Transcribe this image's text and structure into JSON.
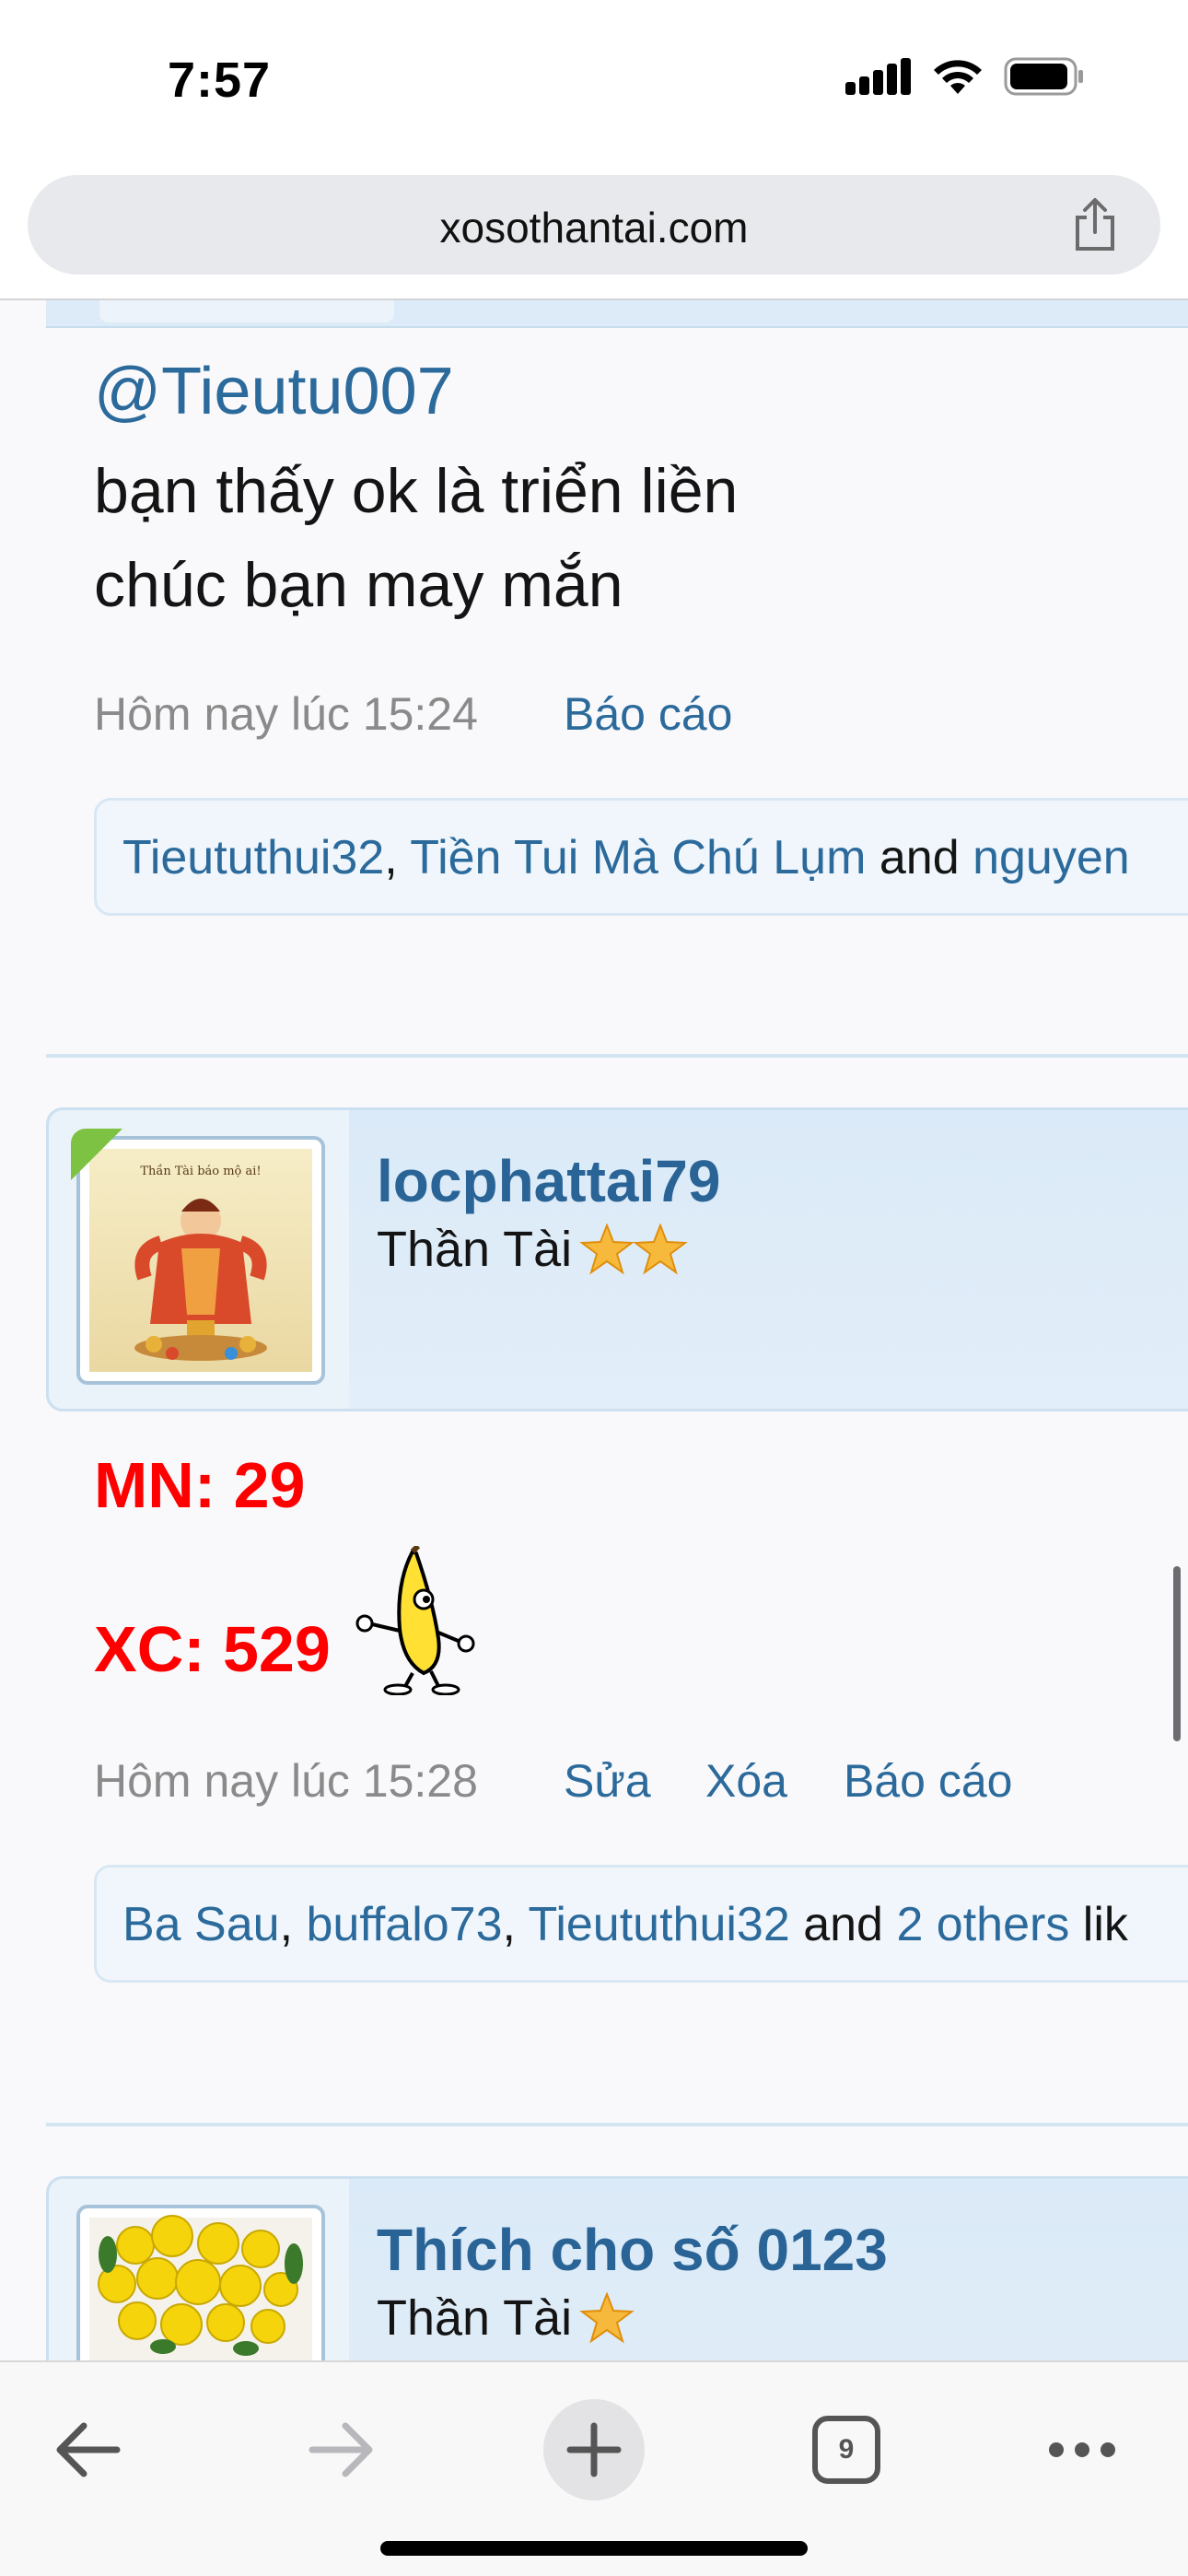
{
  "status_bar": {
    "time": "7:57"
  },
  "browser": {
    "url": "xosothantai.com",
    "tab_count": "9"
  },
  "posts": [
    {
      "mention": "@Tieutu007",
      "lines": [
        "bạn thấy ok là triển liền",
        "chúc bạn may mắn"
      ],
      "timestamp": "Hôm nay lúc 15:24",
      "actions": [
        "Báo cáo"
      ],
      "likes": {
        "users": [
          "Tieututhui32",
          "Tiền Tui Mà Chú Lụm",
          "nguyen"
        ],
        "and_text": "and",
        "sep": ", "
      }
    },
    {
      "username": "locphattai79",
      "title": "Thần Tài",
      "stars": 2,
      "content_lines": [
        "MN: 29",
        "XC: 529"
      ],
      "timestamp": "Hôm nay lúc 15:28",
      "actions": [
        "Sửa",
        "Xóa",
        "Báo cáo"
      ],
      "likes": {
        "users": [
          "Ba Sau",
          "buffalo73",
          "Tieututhui32"
        ],
        "and_text": "and",
        "others": "2 others",
        "suffix": "lik",
        "sep": ", "
      }
    },
    {
      "username": "Thích cho số 0123",
      "title": "Thần Tài",
      "stars": 1
    }
  ],
  "avatar_caption": "Thần Tài báo mộ ai!",
  "colors": {
    "link": "#2b6a9b",
    "username": "#2a6496",
    "highlight_red": "#ff0000",
    "card_bg": "#dbeaf8"
  }
}
